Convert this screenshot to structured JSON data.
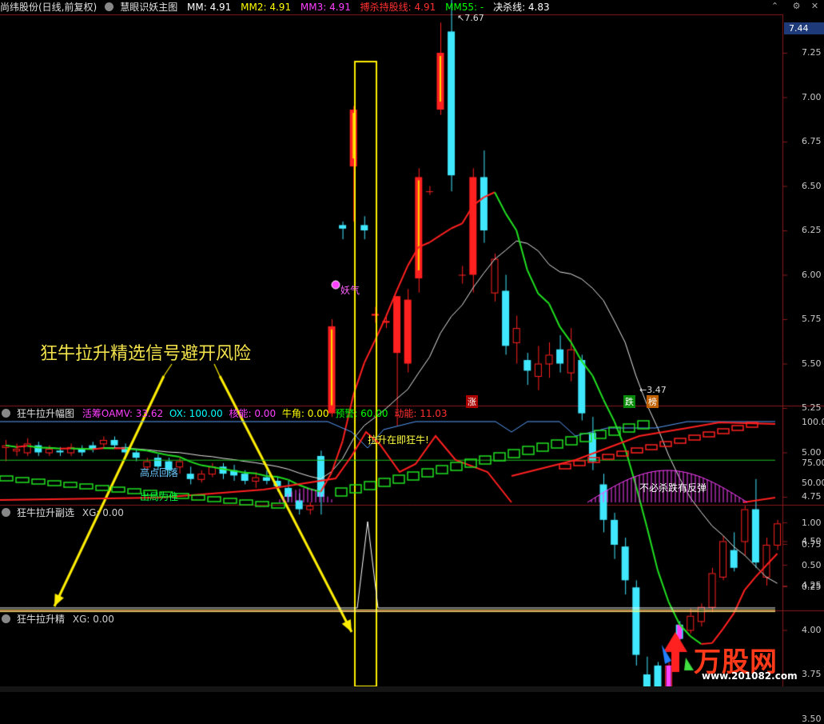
{
  "header": {
    "stock": "尚纬股份(日线,前复权)",
    "indicator": "慧眼识妖主图",
    "mm": "MM: 4.91",
    "mm2": "MM2: 4.91",
    "mm3": "MM3: 4.91",
    "bosha": "搏杀持股线: 4.91",
    "mm55": "MM55: -",
    "juesha": "决杀线: 4.83",
    "current_price": "7.44",
    "colors": {
      "mm": "#ffffff",
      "mm2": "#ffff00",
      "mm3": "#ff40ff",
      "bosha": "#ff3030",
      "mm55": "#00ff00",
      "juesha": "#ffffff"
    }
  },
  "main": {
    "y_ticks": [
      "7.25",
      "7.00",
      "6.75",
      "6.50",
      "6.25",
      "6.00",
      "5.75",
      "5.50",
      "5.25",
      "5.00",
      "4.75",
      "4.50",
      "4.25",
      "4.00",
      "3.75",
      "3.50"
    ],
    "high_label": "7.67",
    "low_label": "3.47",
    "signal_label": "妖气",
    "annotation": "狂牛拉升精选信号避开风险",
    "markers": [
      "涨",
      "跌",
      "榜"
    ]
  },
  "pane2": {
    "title": "狂牛拉升幅图",
    "fields": [
      "活筹OAMV: 33.62",
      "OX: 100.00",
      "核能: 0.00",
      "牛角: 0.00",
      "预警: 60.00",
      "动能: 11.03"
    ],
    "field_colors": [
      "#ff40ff",
      "#00ffff",
      "#ff40ff",
      "#ffff00",
      "#00ff00",
      "#ff3030"
    ],
    "y_ticks": [
      "100.0",
      "75.00",
      "50.00"
    ],
    "labels": {
      "high_drop": "高点回落",
      "exit": "出局为佳",
      "rally": "拉升在即狂牛!",
      "rebound": "不必杀跌有反弹"
    }
  },
  "pane3": {
    "title": "狂牛拉升副选",
    "field": "XG: 0.00",
    "y_ticks": [
      "1.00",
      "0.75",
      "0.50",
      "0.25"
    ]
  },
  "pane4": {
    "title": "狂牛拉升精",
    "field": "XG: 0.00"
  },
  "brand": {
    "name": "万股网",
    "url": "www.201082.com"
  },
  "chart_data": {
    "type": "candlestick",
    "y_range": [
      3.35,
      7.75
    ],
    "candles": [
      [
        5.03,
        5.04,
        4.95,
        5.07
      ],
      [
        5.01,
        5.02,
        4.98,
        5.05
      ],
      [
        5.0,
        5.05,
        4.98,
        5.08
      ],
      [
        5.04,
        5.0,
        4.98,
        5.06
      ],
      [
        5.0,
        5.02,
        4.98,
        5.04
      ],
      [
        5.01,
        5.0,
        4.98,
        5.03
      ],
      [
        5.0,
        5.03,
        4.98,
        5.05
      ],
      [
        5.02,
        5.0,
        4.98,
        5.04
      ],
      [
        5.04,
        5.02,
        5.0,
        5.06
      ],
      [
        5.05,
        5.07,
        5.02,
        5.09
      ],
      [
        5.07,
        5.04,
        5.02,
        5.09
      ],
      [
        5.03,
        5.0,
        4.98,
        5.05
      ],
      [
        5.0,
        4.97,
        4.95,
        5.02
      ],
      [
        4.92,
        4.95,
        4.9,
        4.97
      ],
      [
        4.97,
        4.92,
        4.9,
        4.99
      ],
      [
        4.95,
        4.9,
        4.87,
        4.97
      ],
      [
        4.92,
        4.95,
        4.88,
        4.97
      ],
      [
        4.88,
        4.85,
        4.82,
        4.92
      ],
      [
        4.85,
        4.88,
        4.83,
        4.9
      ],
      [
        4.88,
        4.92,
        4.86,
        4.94
      ],
      [
        4.92,
        4.88,
        4.85,
        4.94
      ],
      [
        4.9,
        4.87,
        4.84,
        4.93
      ],
      [
        4.88,
        4.84,
        4.82,
        4.9
      ],
      [
        4.84,
        4.86,
        4.8,
        4.89
      ],
      [
        4.86,
        4.84,
        4.82,
        4.9
      ],
      [
        4.84,
        4.81,
        4.78,
        4.86
      ],
      [
        4.8,
        4.75,
        4.72,
        4.84
      ],
      [
        4.73,
        4.68,
        4.65,
        4.77
      ],
      [
        4.68,
        4.7,
        4.65,
        4.72
      ],
      [
        4.98,
        4.75,
        4.65,
        5.01
      ],
      [
        5.22,
        5.71,
        5.2,
        5.75
      ],
      [
        6.28,
        6.26,
        6.2,
        6.3
      ],
      [
        6.61,
        6.93,
        6.3,
        6.95
      ],
      [
        6.28,
        6.25,
        6.2,
        6.33
      ],
      [
        5.77,
        5.78,
        5.73,
        5.82
      ],
      [
        5.73,
        5.74,
        5.7,
        5.78
      ],
      [
        5.56,
        5.88,
        5.15,
        5.88
      ],
      [
        5.5,
        5.86,
        5.45,
        5.92
      ],
      [
        5.98,
        6.55,
        5.9,
        6.6
      ],
      [
        6.47,
        6.47,
        6.45,
        6.5
      ],
      [
        6.93,
        7.25,
        6.9,
        7.42
      ],
      [
        7.37,
        6.56,
        6.47,
        7.67
      ],
      [
        6.0,
        6.0,
        5.95,
        6.05
      ],
      [
        6.0,
        6.55,
        5.9,
        6.6
      ],
      [
        6.55,
        6.25,
        6.18,
        6.7
      ],
      [
        5.9,
        6.09,
        5.85,
        6.12
      ],
      [
        5.91,
        5.6,
        5.55,
        6.0
      ],
      [
        5.62,
        5.7,
        5.5,
        5.77
      ],
      [
        5.52,
        5.46,
        5.38,
        5.56
      ],
      [
        5.43,
        5.5,
        5.35,
        5.6
      ],
      [
        5.5,
        5.55,
        5.42,
        5.62
      ],
      [
        5.58,
        5.5,
        5.45,
        5.66
      ],
      [
        5.45,
        5.58,
        5.4,
        5.7
      ],
      [
        5.52,
        5.22,
        5.18,
        5.55
      ],
      [
        5.11,
        4.95,
        4.9,
        5.2
      ],
      [
        4.82,
        4.62,
        4.55,
        4.88
      ],
      [
        4.62,
        4.48,
        4.4,
        4.66
      ],
      [
        4.47,
        4.28,
        4.2,
        4.52
      ],
      [
        4.24,
        3.86,
        3.8,
        4.28
      ],
      [
        3.75,
        3.65,
        3.62,
        3.85
      ],
      [
        3.8,
        3.62,
        3.58,
        3.82
      ],
      [
        3.62,
        3.8,
        3.47,
        3.82
      ],
      [
        4.03,
        3.95,
        3.92,
        4.05
      ],
      [
        4.0,
        4.08,
        3.98,
        4.12
      ],
      [
        4.05,
        4.13,
        4.02,
        4.15
      ],
      [
        4.13,
        4.32,
        4.1,
        4.35
      ],
      [
        4.3,
        4.5,
        4.28,
        4.53
      ],
      [
        4.45,
        4.35,
        4.33,
        4.55
      ],
      [
        4.5,
        4.68,
        4.42,
        4.7
      ],
      [
        4.68,
        4.38,
        4.35,
        4.85
      ],
      [
        4.3,
        4.48,
        4.25,
        4.52
      ],
      [
        4.48,
        4.6,
        4.45,
        4.62
      ]
    ]
  }
}
